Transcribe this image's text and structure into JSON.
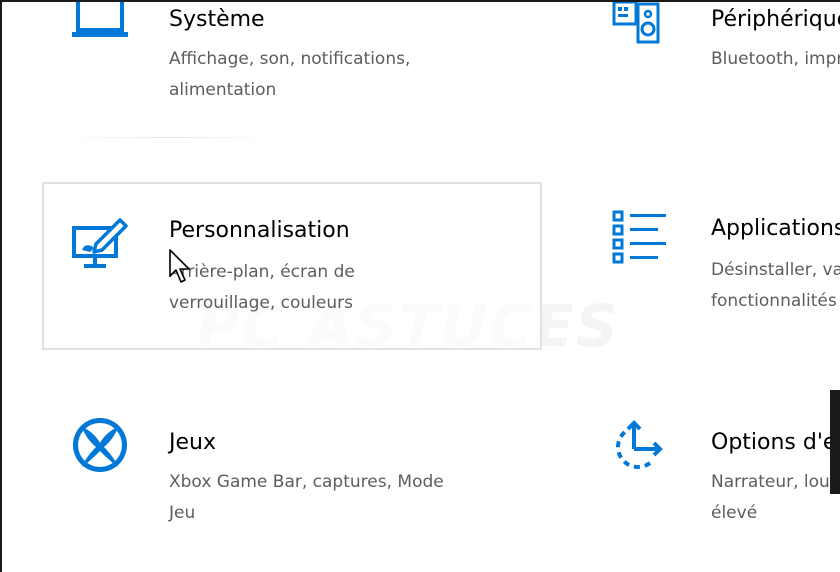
{
  "colors": {
    "accent": "#0078d7",
    "title_text": "#000000",
    "desc_text": "#5d5d5d",
    "selected_border": "#e1e1e1"
  },
  "watermark": "PC ASTUCES",
  "tiles": {
    "systeme": {
      "icon": "laptop-icon",
      "title": "Système",
      "desc_line1": "Affichage, son, notifications,",
      "desc_line2": "alimentation"
    },
    "peripheriques": {
      "icon": "devices-icon",
      "title": "Périphériques",
      "desc_line1": "Bluetooth, imprimantes, souris"
    },
    "personnalisation": {
      "icon": "personalization-icon",
      "title": "Personnalisation",
      "desc_line1": "Arrière-plan, écran de",
      "desc_line2": "verrouillage, couleurs"
    },
    "applications": {
      "icon": "apps-list-icon",
      "title": "Applications",
      "desc_line1": "Désinstaller, valeurs par défaut,",
      "desc_line2": "fonctionnalités facultatives"
    },
    "jeux": {
      "icon": "xbox-icon",
      "title": "Jeux",
      "desc_line1": "Xbox Game Bar, captures, Mode",
      "desc_line2": "Jeu"
    },
    "options_ergonomie": {
      "icon": "ease-of-access-icon",
      "title": "Options d'ergonomie",
      "desc_line1": "Narrateur, loupe, contraste",
      "desc_line2": "élevé"
    }
  }
}
